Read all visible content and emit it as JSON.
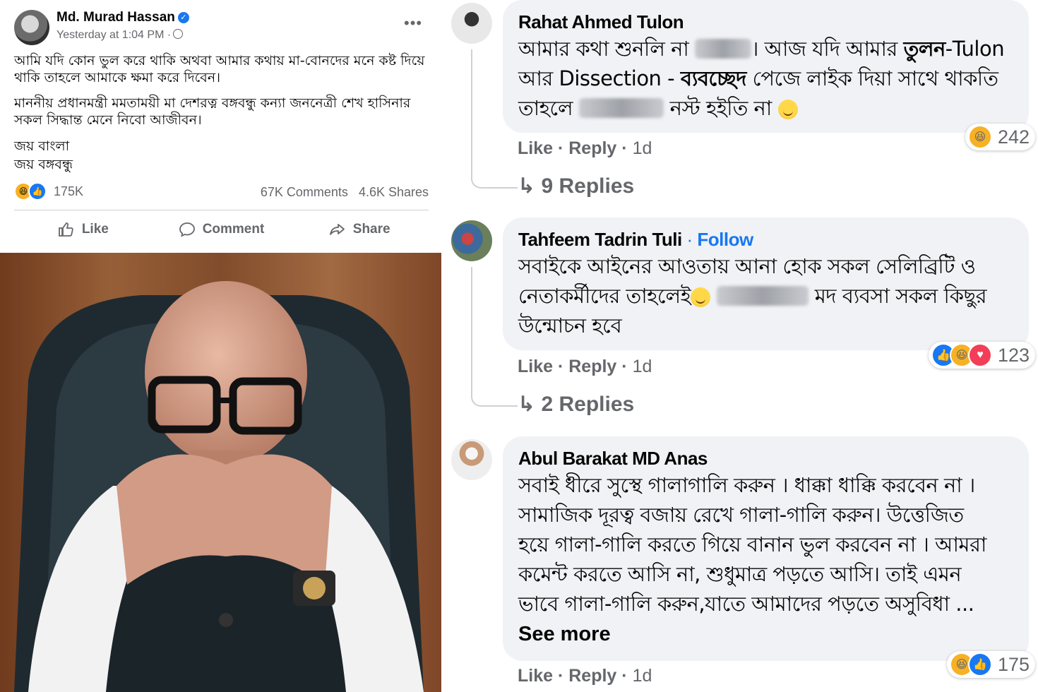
{
  "post": {
    "author": "Md. Murad Hassan",
    "timestamp": "Yesterday at 1:04 PM ·",
    "paragraph1": "আমি যদি কোন ভুল করে থাকি অথবা আমার কথায় মা-বোনদের মনে কষ্ট দিয়ে থাকি তাহলে আমাকে ক্ষমা করে দিবেন।",
    "paragraph2": "মাননীয় প্রধানমন্ত্রী মমতাময়ী মা দেশরত্ন বঙ্গবন্ধু কন্যা জননেত্রী শেখ হাসিনার সকল সিদ্ধান্ত মেনে নিবো আজীবন।",
    "paragraph3_line1": "জয় বাংলা",
    "paragraph3_line2": "জয় বঙ্গবন্ধু",
    "reactions_count": "175K",
    "comments_count": "67K Comments",
    "shares_count": "4.6K Shares",
    "actions": {
      "like": "Like",
      "comment": "Comment",
      "share": "Share"
    },
    "icons": [
      "haha-icon",
      "like-icon",
      "verified-icon",
      "globe-icon",
      "more-icon",
      "like-outline-icon",
      "comment-outline-icon",
      "share-outline-icon"
    ]
  },
  "comments": [
    {
      "author": "Rahat Ahmed Tulon",
      "text_line1_a": "আমার কথা শুনলি না",
      "text_line1_b": "। আজ যদি আমার",
      "text_line1_bold": "তুলন",
      "text_line1_c": "-Tulon",
      "text_line2_a": "আর Dissection -",
      "text_line2_bold": "ব্যবচ্ছেদ",
      "text_line2_b": "পেজে লাইক দিয়া সাথে থাকতি",
      "text_line3_a": "তাহলে",
      "text_line3_b": "নস্ট হইতি না",
      "reaction_count": "242",
      "like": "Like",
      "reply": "Reply",
      "time": "1d",
      "replies": "9 Replies"
    },
    {
      "author": "Tahfeem Tadrin Tuli",
      "follow": "Follow",
      "text_line1": "সবাইকে আইনের আওতায় আনা হোক সকল সেলিব্রিটি ও",
      "text_line2_a": "নেতাকর্মীদের তাহলেই",
      "text_line2_b": "মদ ব্যবসা সকল কিছুর",
      "text_line3": "উন্মোচন হবে",
      "reaction_count": "123",
      "like": "Like",
      "reply": "Reply",
      "time": "1d",
      "replies": "2 Replies"
    },
    {
      "author": "Abul Barakat MD Anas",
      "text_line1": "সবাই ধীরে সুস্থে গালাগালি করুন । ধাক্কা ধাক্কি করবেন না ।",
      "text_line2": "সামাজিক দূরত্ব বজায় রেখে গালা-গালি করুন। উত্তেজিত",
      "text_line3": "হয়ে গালা-গালি করতে গিয়ে বানান ভুল করবেন না । আমরা",
      "text_line4": "কমেন্ট করতে আসি না, শুধুমাত্র পড়তে আসি। তাই এমন",
      "text_line5": "ভাবে গালা-গালি করুন,যাতে আমাদের পড়তে অসুবিধা ...",
      "see_more": "See more",
      "reaction_count": "175",
      "like": "Like",
      "reply": "Reply",
      "time": "1d"
    }
  ],
  "colors": {
    "fb_blue": "#1877f2",
    "bubble_bg": "#f0f2f5",
    "muted": "#65676b",
    "haha": "#f7b125",
    "love": "#f33e58"
  }
}
